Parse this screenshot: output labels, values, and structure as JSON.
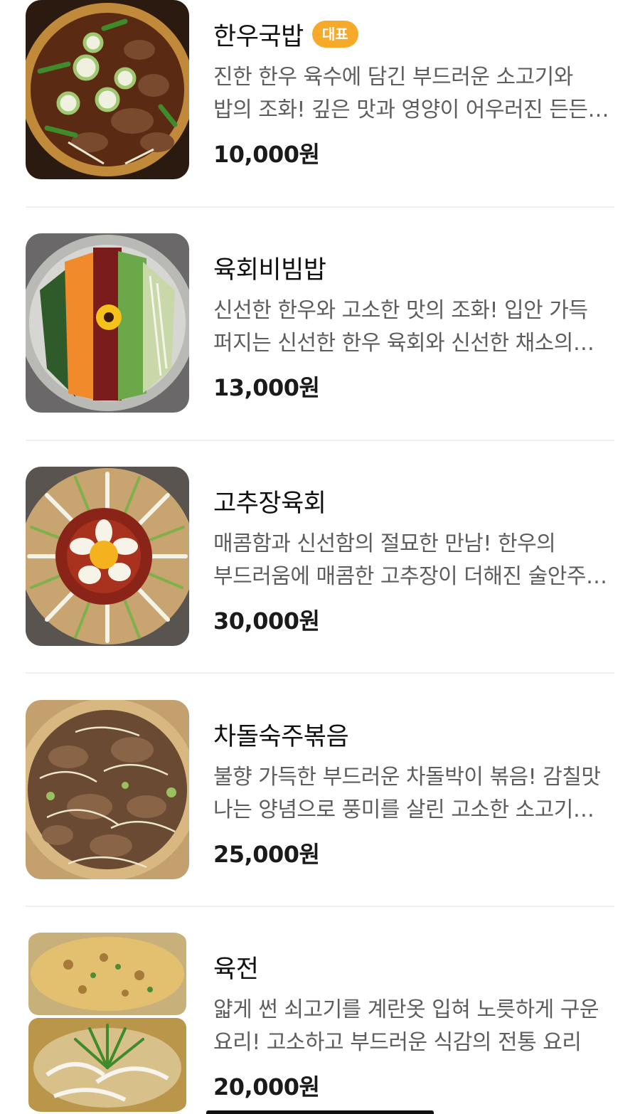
{
  "menu": {
    "items": [
      {
        "name": "한우국밥",
        "badge": "대표",
        "description": "진한 한우 육수에 담긴 부드러운 소고기와 밥의 조화! 깊은 맛과 영양이 어우러진 든든한 한 그릇",
        "price": "10,000원",
        "image_icon": "beef-soup-bowl-photo"
      },
      {
        "name": "육회비빔밥",
        "description": "신선한 한우와 고소한 맛의 조화! 입안 가득 퍼지는 신선한 한우 육회와 신선한 채소의 어우러짐",
        "price": "13,000원",
        "image_icon": "yukhoe-bibimbap-photo"
      },
      {
        "name": "고추장육회",
        "description": "매콤함과 신선함의 절묘한 만남! 한우의 부드러움에 매콤한 고추장이 더해진 술안주로 제격인 메뉴",
        "price": "30,000원",
        "image_icon": "gochujang-yukhoe-photo"
      },
      {
        "name": "차돌숙주볶음",
        "description": "불향 가득한 부드러운 차돌박이 볶음! 감칠맛 나는 양념으로 풍미를 살린 고소한 소고기 요리",
        "price": "25,000원",
        "image_icon": "chadol-sukju-stirfry-photo"
      },
      {
        "name": "육전",
        "description": "얇게 썬 쇠고기를 계란옷 입혀 노릇하게 구운 요리! 고소하고 부드러운 식감의 전통 요리",
        "price": "20,000원",
        "image_icon": "yukjeon-photo"
      }
    ]
  }
}
